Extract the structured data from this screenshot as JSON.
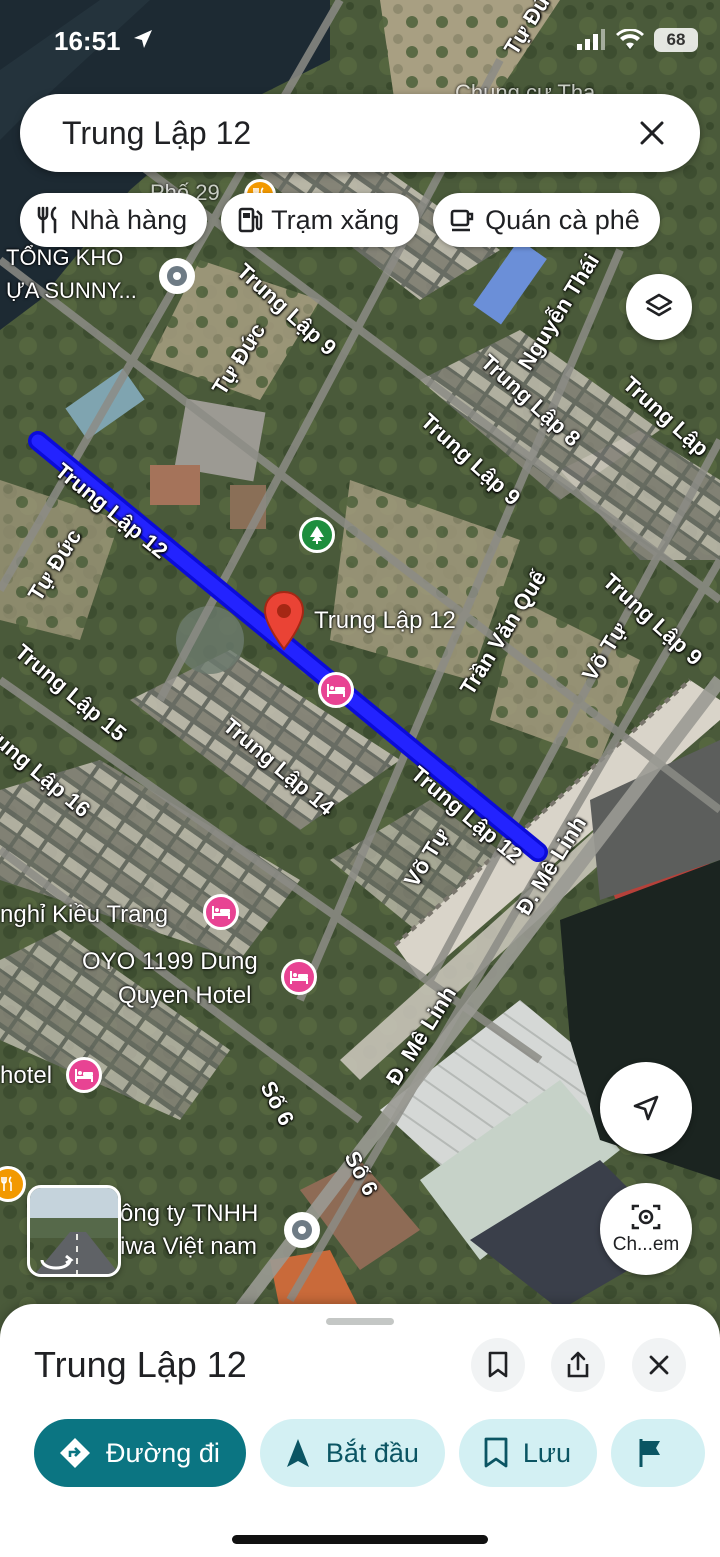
{
  "status_bar": {
    "time": "16:51",
    "battery": "68"
  },
  "search": {
    "query": "Trung Lập 12"
  },
  "chips": [
    {
      "label": "Nhà hàng",
      "icon": "restaurant-icon"
    },
    {
      "label": "Trạm xăng",
      "icon": "gas-station-icon"
    },
    {
      "label": "Quán cà phê",
      "icon": "coffee-icon"
    }
  ],
  "map": {
    "streets": {
      "trung_lap_12_a": "Trung Lập 12",
      "trung_lap_12_b": "Trung Lập 12",
      "trung_lap_9_a": "Trung Lập 9",
      "trung_lap_9_b": "Trung Lập 9",
      "trung_lap_9_c": "Trung Lập 9",
      "trung_lap_8": "Trung Lập 8",
      "trung_lap_14": "Trung Lập 14",
      "trung_lap_15": "Trung Lập 15",
      "trung_lap_16": "Trung Lập 16",
      "trung_lap_edge": "Trung Lập",
      "tu_duc_a": "Tự Đức",
      "tu_duc_b": "Tự Đức",
      "tu_duc_top": "Tự Đứ",
      "nguyen_thai": "Nguyễn Thái",
      "tran_van_que": "Trần Văn Quế",
      "vo_tu_a": "Võ Tự",
      "vo_tu_b": "Võ Tự",
      "me_linh_a": "Đ. Mê Linh",
      "me_linh_b": "Đ. Mê Linh",
      "so_6_a": "Số 6",
      "so_6_b": "Số 6"
    },
    "places": {
      "selected_pin_label": "Trung Lập 12",
      "tong_kho_line1": "TỔNG KHO",
      "tong_kho_line2": "ỰA SUNNY...",
      "kieu_trang": "nghỉ Kiều Trang",
      "oyo_line1": "OYO 1199 Dung",
      "oyo_line2": "Quyen Hotel",
      "hotel_left": "hotel",
      "cong_ty_line1": "ông ty TNHH",
      "cong_ty_line2": "iwa Việt nam",
      "top_partial": "Chung cư Tha",
      "road_29": "Phố 29"
    },
    "colors": {
      "route": "#1a1aff",
      "pin": "#ea4335",
      "hotel_poi": "#e84393",
      "park_poi": "#1e8e3e",
      "restaurant_poi": "#f29900",
      "generic_poi": "#5f6368"
    }
  },
  "map_buttons": {
    "camera_label": "Ch...em"
  },
  "sheet": {
    "title": "Trung Lập 12",
    "actions": {
      "directions": "Đường đi",
      "start": "Bắt đầu",
      "save": "Lưu"
    }
  }
}
